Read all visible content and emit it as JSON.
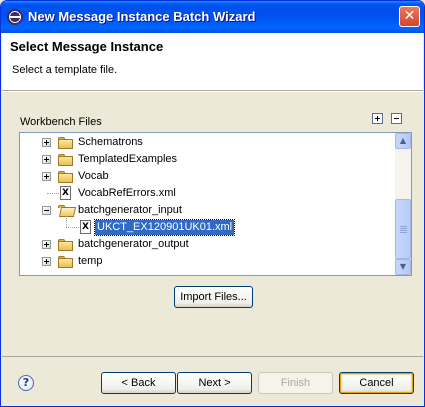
{
  "window": {
    "title": "New Message Instance Batch Wizard",
    "close_label": "✕"
  },
  "header": {
    "title": "Select Message Instance",
    "description": "Select a template file."
  },
  "workbench": {
    "label": "Workbench Files"
  },
  "tree": {
    "items": [
      {
        "label": "Schematrons",
        "type": "folder",
        "expanded": false
      },
      {
        "label": "TemplatedExamples",
        "type": "folder",
        "expanded": false
      },
      {
        "label": "Vocab",
        "type": "folder",
        "expanded": false
      },
      {
        "label": "VocabRefErrors.xml",
        "type": "xml-file"
      },
      {
        "label": "batchgenerator_input",
        "type": "folder",
        "expanded": true
      },
      {
        "label": "UKCT_EX120901UK01.xml",
        "type": "xml-file",
        "selected": true
      },
      {
        "label": "batchgenerator_output",
        "type": "folder",
        "expanded": false
      },
      {
        "label": "temp",
        "type": "folder",
        "expanded": false
      }
    ]
  },
  "buttons": {
    "import": "Import Files...",
    "back": "< Back",
    "next": "Next >",
    "finish": "Finish",
    "cancel": "Cancel"
  },
  "icons": {
    "help": "?",
    "xml_file": "X",
    "scroll_up": "▲",
    "scroll_down": "▼"
  },
  "colors": {
    "selection": "#316ac5",
    "titlebar": "#0053ee",
    "dialog_bg": "#ece9d8"
  }
}
